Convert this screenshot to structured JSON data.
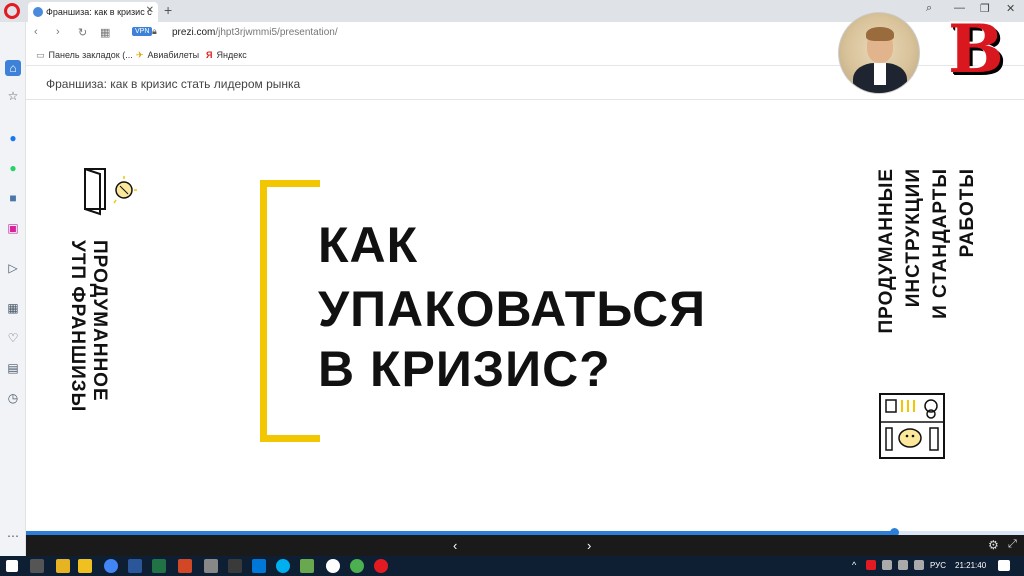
{
  "browser": {
    "tab_title": "Франшиза: как в кризис с",
    "url_host": "prezi.com",
    "url_path": "/jhpt3rjwmmi5/presentation/",
    "vpn_label": "VPN",
    "bookmarks": [
      {
        "label": "Панель закладок (...",
        "icon": "folder-icon"
      },
      {
        "label": "Авиабилеты",
        "icon": "plane-icon"
      },
      {
        "label": "Яндекс",
        "icon": "yandex-icon"
      }
    ]
  },
  "prezi": {
    "title": "Франшиза: как в кризис стать лидером рынка"
  },
  "slide": {
    "headline_lines": [
      "КАК",
      "УПАКОВАТЬСЯ",
      "В КРИЗИС?"
    ],
    "left_caption_lines": [
      "ПРОДУМАННОЕ",
      "УТП ФРАНШИЗЫ"
    ],
    "right_caption_lines": [
      "ПРОДУМАННЫЕ",
      "ИНСТРУКЦИИ",
      "И СТАНДАРТЫ",
      "РАБОТЫ"
    ],
    "accent_color": "#f2c600"
  },
  "presentation": {
    "progress_fraction": 0.87
  },
  "taskbar": {
    "language": "РУС",
    "time": "21:21:40"
  }
}
